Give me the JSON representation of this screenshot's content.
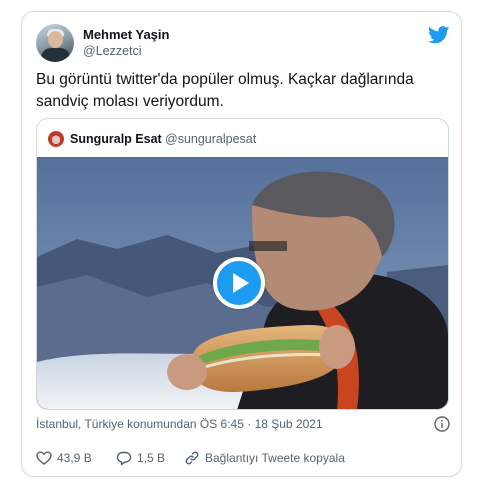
{
  "author": {
    "name": "Mehmet Yaşin",
    "handle": "@Lezzetci"
  },
  "tweet": {
    "text_line1": "Bu görüntü twitter'da popüler olmuş. Kaçkar dağlarında",
    "text_line2": "sandviç molası veriyordum."
  },
  "quoted": {
    "name": "Sunguralp Esat",
    "handle": "@sunguralpesat",
    "media": "video"
  },
  "meta": {
    "location_time": "İstanbul, Türkiye konumundan ÖS 6:45 · 18 Şub 2021"
  },
  "actions": {
    "likes": "43,9 B",
    "replies": "1,5 B",
    "copy_link": "Bağlantıyı Tweete kopyala"
  },
  "icons": {
    "brand": "twitter-bird-icon",
    "play": "play-icon",
    "info": "info-icon",
    "like": "heart-icon",
    "reply": "reply-icon",
    "copy": "link-icon"
  },
  "colors": {
    "accent": "#1d9bf0",
    "text": "#0f1419",
    "secondary": "#536471",
    "border": "#cfd9de"
  }
}
